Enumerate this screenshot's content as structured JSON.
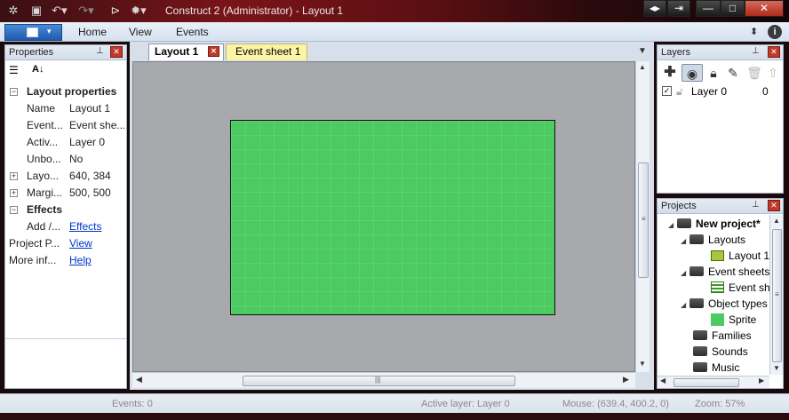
{
  "window": {
    "title": "Construct 2 (Administrator) - Layout 1",
    "quick_access": [
      "gear-icon",
      "save-icon",
      "undo-icon",
      "redo-icon",
      "play-icon",
      "debug-icon"
    ],
    "controls": {
      "restore_down": "◂▸",
      "signout": "⇥",
      "minimize": "—",
      "maximize": "□",
      "close": "✕"
    }
  },
  "ribbon": {
    "app_menu_icon": "app-menu-icon",
    "tabs": [
      "Home",
      "View",
      "Events"
    ],
    "right_icons": [
      "collapse-icon",
      "info-icon"
    ]
  },
  "properties": {
    "header": "Properties",
    "toolbar": [
      "sort-categorized-icon",
      "sort-alphabetical-icon"
    ],
    "section_layout": "Layout properties",
    "rows": [
      {
        "key": "Name",
        "value": "Layout 1"
      },
      {
        "key": "Event...",
        "value": "Event she..."
      },
      {
        "key": "Activ...",
        "value": "Layer 0"
      },
      {
        "key": "Unbo...",
        "value": "No"
      },
      {
        "key": "Layo...",
        "value": "640, 384"
      },
      {
        "key": "Margi...",
        "value": "500, 500"
      }
    ],
    "section_effects": "Effects",
    "effects_row": {
      "key": "Add /...",
      "value": "Effects"
    },
    "project_row": {
      "key": "Project P...",
      "value": "View"
    },
    "more_row": {
      "key": "More inf...",
      "value": "Help"
    }
  },
  "editor": {
    "tabs": [
      {
        "label": "Layout 1",
        "active": true
      },
      {
        "label": "Event sheet 1",
        "active": false
      }
    ],
    "layout_color": "#4ccb61"
  },
  "layers": {
    "header": "Layers",
    "toolbar": [
      "add-layer-icon",
      "visibility-icon",
      "lock-icon",
      "edit-icon",
      "delete-icon",
      "move-up-icon"
    ],
    "items": [
      {
        "name": "Layer 0",
        "count": "0",
        "visible": true
      }
    ]
  },
  "projects": {
    "header": "Projects",
    "tree": [
      {
        "label": "New project*",
        "level": 0,
        "bold": true,
        "icon": "folder"
      },
      {
        "label": "Layouts",
        "level": 1,
        "icon": "folder"
      },
      {
        "label": "Layout 1",
        "level": 2,
        "icon": "layout"
      },
      {
        "label": "Event sheets",
        "level": 1,
        "icon": "folder"
      },
      {
        "label": "Event sh",
        "level": 2,
        "icon": "eventsheet"
      },
      {
        "label": "Object types",
        "level": 1,
        "icon": "folder"
      },
      {
        "label": "Sprite",
        "level": 2,
        "icon": "sprite"
      },
      {
        "label": "Families",
        "level": 1,
        "icon": "folder"
      },
      {
        "label": "Sounds",
        "level": 1,
        "icon": "folder"
      },
      {
        "label": "Music",
        "level": 1,
        "icon": "folder"
      }
    ]
  },
  "status": {
    "events": "Events: 0",
    "active_layer": "Active layer: Layer 0",
    "mouse": "Mouse: (639.4, 400.2, 0)",
    "zoom": "Zoom: 57%"
  }
}
